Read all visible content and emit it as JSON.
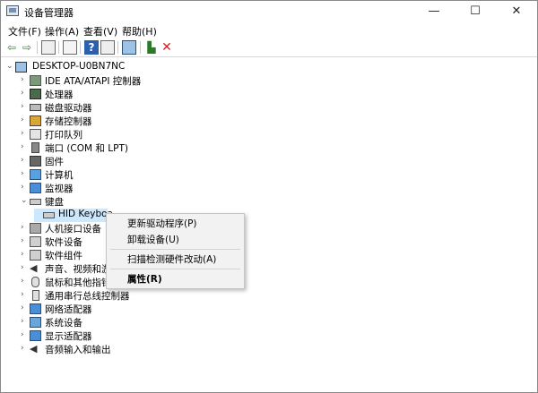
{
  "window": {
    "title": "设备管理器",
    "minimize": "—",
    "maximize": "☐",
    "close": "✕"
  },
  "menu": [
    "文件(F)",
    "操作(A)",
    "查看(V)",
    "帮助(H)"
  ],
  "toolbar_icons": [
    "back-arrow-icon",
    "forward-arrow-icon",
    "show-hide-console-tree-icon",
    "properties-icon",
    "help-icon",
    "action-pane-icon",
    "scan-monitor-icon",
    "update-driver-icon",
    "uninstall-icon"
  ],
  "tree": {
    "root": "DESKTOP-U0BN7NC",
    "items": [
      {
        "label": "IDE ATA/ATAPI 控制器",
        "icon": "ide-controller-icon",
        "expander": "›"
      },
      {
        "label": "处理器",
        "icon": "processor-icon",
        "expander": "›"
      },
      {
        "label": "磁盘驱动器",
        "icon": "disk-drive-icon",
        "expander": "›"
      },
      {
        "label": "存储控制器",
        "icon": "storage-controller-icon",
        "expander": "›"
      },
      {
        "label": "打印队列",
        "icon": "printer-icon",
        "expander": "›"
      },
      {
        "label": "端口 (COM 和 LPT)",
        "icon": "port-icon",
        "expander": "›"
      },
      {
        "label": "固件",
        "icon": "firmware-icon",
        "expander": "›"
      },
      {
        "label": "计算机",
        "icon": "computer-icon",
        "expander": "›"
      },
      {
        "label": "监视器",
        "icon": "monitor-icon",
        "expander": "›"
      },
      {
        "label": "键盘",
        "icon": "keyboard-icon",
        "expander": "⌄"
      },
      {
        "label": "HID Keyboa",
        "icon": "keyboard-device-icon",
        "expander": ""
      },
      {
        "label": "人机接口设备",
        "icon": "hid-icon",
        "expander": "›"
      },
      {
        "label": "软件设备",
        "icon": "software-device-icon",
        "expander": "›"
      },
      {
        "label": "软件组件",
        "icon": "software-component-icon",
        "expander": "›"
      },
      {
        "label": "声音、视频和游",
        "icon": "sound-icon",
        "expander": "›"
      },
      {
        "label": "鼠标和其他指针",
        "icon": "mouse-icon",
        "expander": "›"
      },
      {
        "label": "通用串行总线控制器",
        "icon": "usb-icon",
        "expander": "›"
      },
      {
        "label": "网络适配器",
        "icon": "network-adapter-icon",
        "expander": "›"
      },
      {
        "label": "系统设备",
        "icon": "system-device-icon",
        "expander": "›"
      },
      {
        "label": "显示适配器",
        "icon": "display-adapter-icon",
        "expander": "›"
      },
      {
        "label": "音频输入和输出",
        "icon": "audio-io-icon",
        "expander": "›"
      }
    ]
  },
  "context_menu": {
    "update_driver": "更新驱动程序(P)",
    "uninstall": "卸载设备(U)",
    "scan": "扫描检测硬件改动(A)",
    "properties": "属性(R)"
  },
  "colors": {
    "selection": "#cce8ff",
    "menu_bg": "#f2f2f2",
    "red_x": "#d42020"
  }
}
